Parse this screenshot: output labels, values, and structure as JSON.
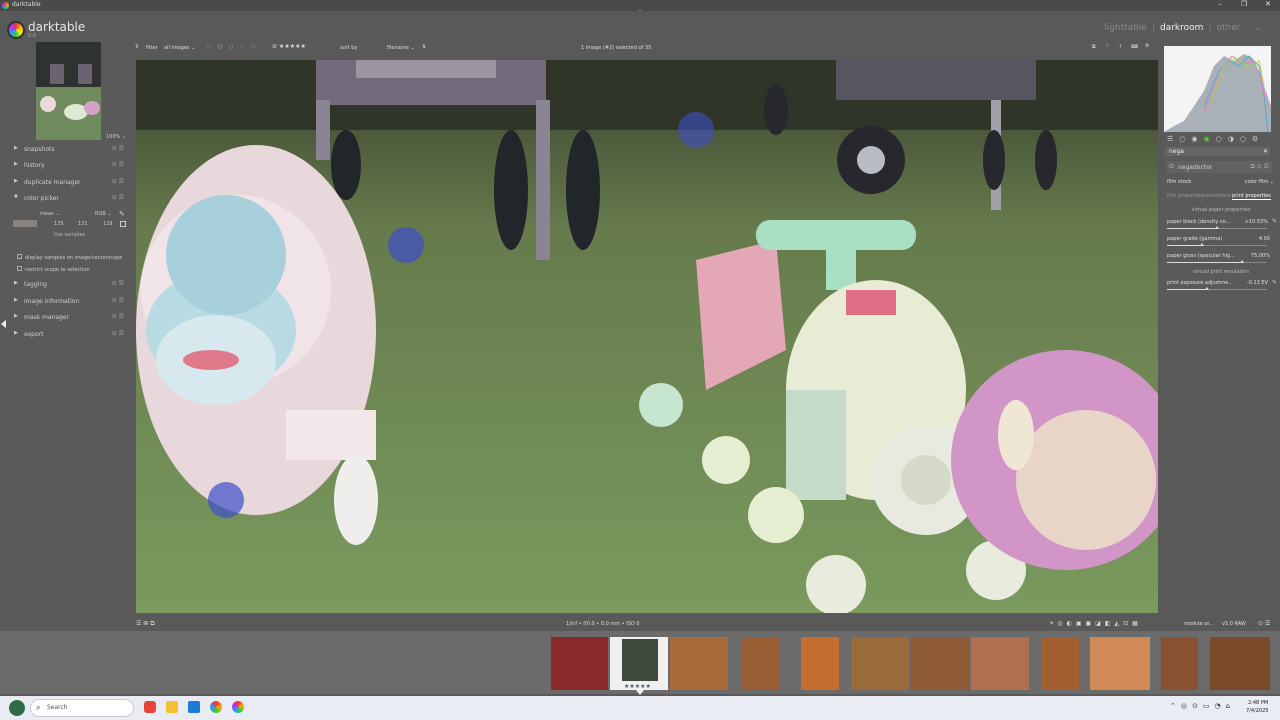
{
  "window": {
    "title": "darktable",
    "controls": {
      "min": "–",
      "max": "❐",
      "close": "✕"
    }
  },
  "app": {
    "name": "darktable",
    "version": "5.0"
  },
  "views": {
    "lighttable": "lighttable",
    "darkroom": "darkroom",
    "other": "other",
    "sep": "|"
  },
  "toolbar": {
    "filter_label": "filter",
    "filter_value": "all images",
    "sort_label": "sort by",
    "sort_value": "filename",
    "selection": "1 image (#2) selected of 35"
  },
  "left": {
    "zoom": "100%",
    "modules": [
      {
        "label": "snapshots",
        "arrow": "▶"
      },
      {
        "label": "history",
        "arrow": "▶"
      },
      {
        "label": "duplicate manager",
        "arrow": "▶"
      },
      {
        "label": "color picker",
        "arrow": "▼"
      },
      {
        "label": "tagging",
        "arrow": "▶"
      },
      {
        "label": "image information",
        "arrow": "▶"
      },
      {
        "label": "mask manager",
        "arrow": "▶"
      },
      {
        "label": "export",
        "arrow": "▶"
      }
    ],
    "module_icons": "⊙ ☰",
    "color_picker": {
      "mode": "mean",
      "space": "RGB",
      "values": [
        "135",
        "131",
        "129"
      ],
      "live_samples": "live samples",
      "display_samples": "display samples on image/vectorscope",
      "restrict_scope": "restrict scope to selection"
    }
  },
  "right": {
    "search": "nega",
    "module_name": "negadoctor",
    "film_stock_label": "film stock",
    "film_stock_value": "color film",
    "tabs": [
      "film properties",
      "corrections",
      "print properties"
    ],
    "virtual_paper": "virtual paper properties",
    "paper_black_label": "paper black (density co...",
    "paper_black_value": "+10.53%",
    "paper_black_fraction": 0.5,
    "paper_grade_label": "paper grade (gamma)",
    "paper_grade_value": "4.00",
    "paper_grade_fraction": 0.35,
    "paper_gloss_label": "paper gloss (specular hig...",
    "paper_gloss_value": "75.00%",
    "paper_gloss_fraction": 0.75,
    "virtual_print": "virtual print emulation",
    "print_exposure_label": "print exposure adjustme...",
    "print_exposure_value": "-0.13 EV",
    "print_exposure_fraction": 0.4
  },
  "bottom": {
    "exif": "1/inf • f/0.0 • 0.0 mm • ISO 0",
    "module_order_label": "module or...",
    "module_order_value": "v5.0 RAW"
  },
  "filmstrip": {
    "stars": "★★★★★"
  },
  "taskbar": {
    "search_placeholder": "Search",
    "time": "2:48 PM",
    "date": "7/4/2025"
  }
}
